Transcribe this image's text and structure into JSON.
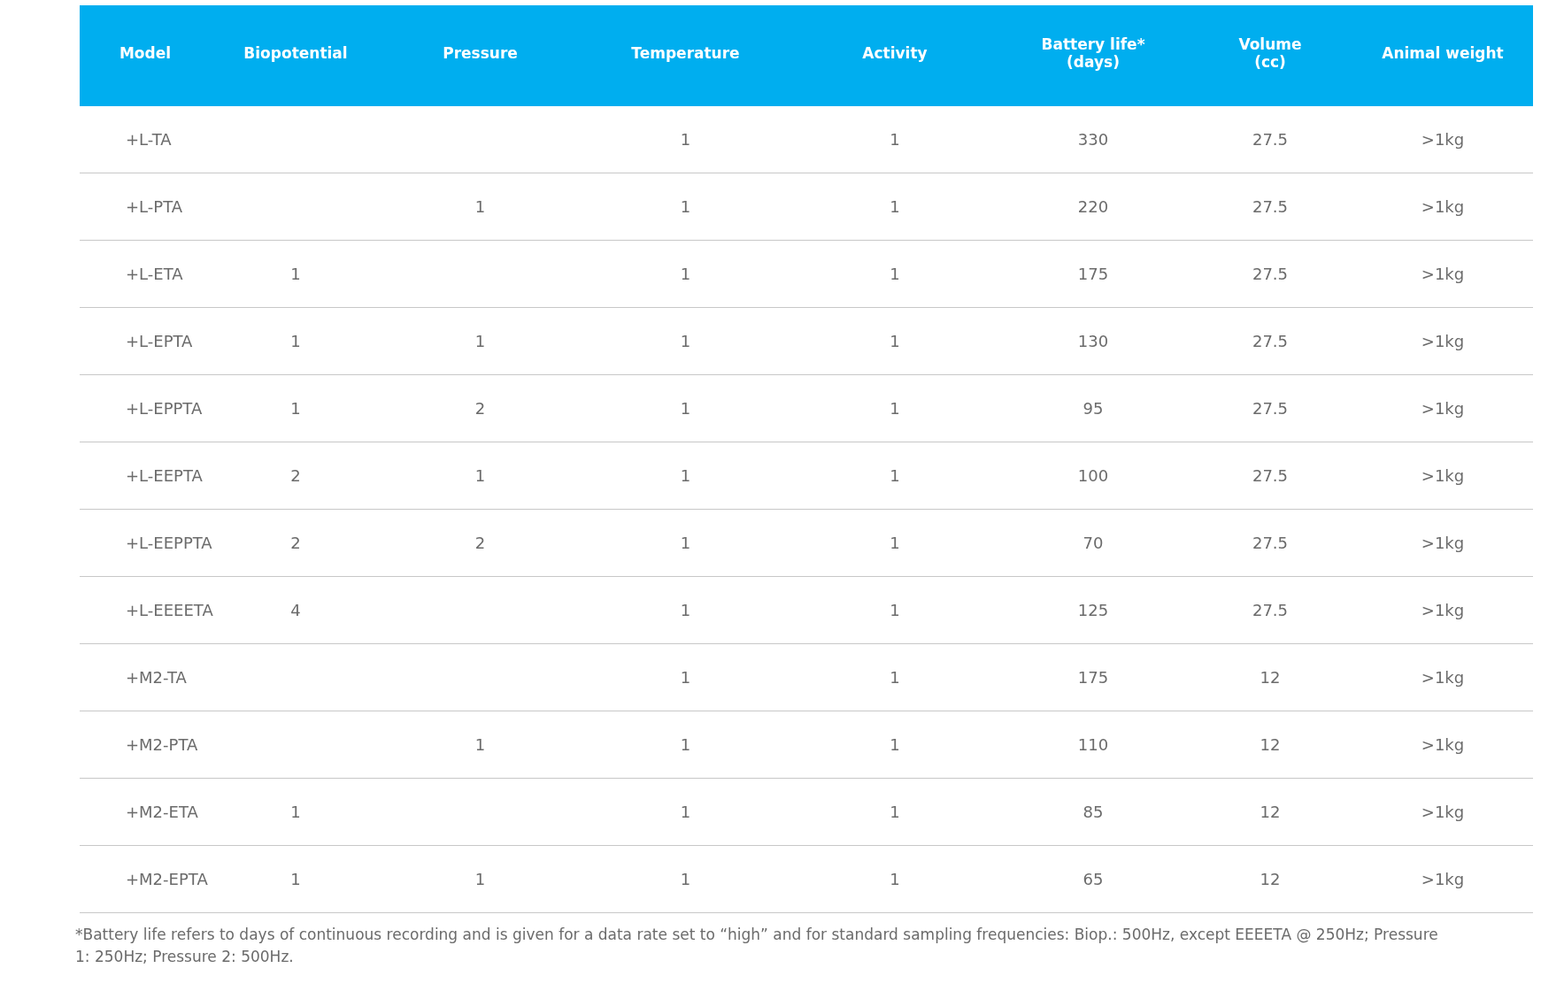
{
  "table": {
    "columns": [
      "Model",
      "Biopotential",
      "Pressure",
      "Temperature",
      "Activity",
      "Battery life*\n(days)",
      "Volume\n(cc)",
      "Animal weight"
    ],
    "rows": [
      {
        "cells": [
          "+L-TA",
          null,
          null,
          "1",
          "1",
          "330",
          "27.5",
          ">1kg"
        ]
      },
      {
        "cells": [
          "+L-PTA",
          null,
          "1",
          "1",
          "1",
          "220",
          "27.5",
          ">1kg"
        ]
      },
      {
        "cells": [
          "+L-ETA",
          "1",
          null,
          "1",
          "1",
          "175",
          "27.5",
          ">1kg"
        ]
      },
      {
        "cells": [
          "+L-EPTA",
          "1",
          "1",
          "1",
          "1",
          "130",
          "27.5",
          ">1kg"
        ]
      },
      {
        "cells": [
          "+L-EPPTA",
          "1",
          "2",
          "1",
          "1",
          "95",
          "27.5",
          ">1kg"
        ]
      },
      {
        "cells": [
          "+L-EEPTA",
          "2",
          "1",
          "1",
          "1",
          "100",
          "27.5",
          ">1kg"
        ]
      },
      {
        "cells": [
          "+L-EEPPTA",
          "2",
          "2",
          "1",
          "1",
          "70",
          "27.5",
          ">1kg"
        ]
      },
      {
        "cells": [
          "+L-EEEETA",
          "4",
          null,
          "1",
          "1",
          "125",
          "27.5",
          ">1kg"
        ]
      },
      {
        "cells": [
          "+M2-TA",
          null,
          null,
          "1",
          "1",
          "175",
          "12",
          ">1kg"
        ]
      },
      {
        "cells": [
          "+M2-PTA",
          null,
          "1",
          "1",
          "1",
          "110",
          "12",
          ">1kg"
        ]
      },
      {
        "cells": [
          "+M2-ETA",
          "1",
          null,
          "1",
          "1",
          "85",
          "12",
          ">1kg"
        ]
      },
      {
        "cells": [
          "+M2-EPTA",
          "1",
          "1",
          "1",
          "1",
          "65",
          "12",
          ">1kg"
        ]
      }
    ]
  },
  "footnote": "*Battery life refers to days of continuous recording and is given for a data rate set to “high” and for standard sampling frequencies: Biop.: 500Hz, except EEEETA @ 250Hz; Pressure 1: 250Hz; Pressure 2: 500Hz."
}
